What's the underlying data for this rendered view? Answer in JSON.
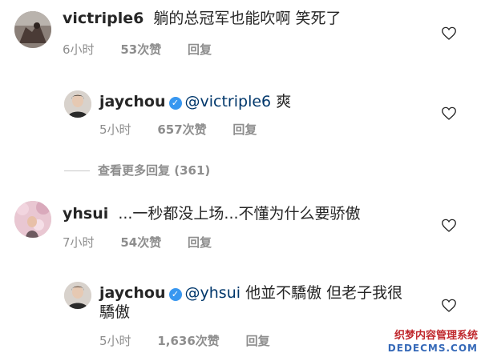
{
  "comments": [
    {
      "username": "victriple6",
      "text": "躺的总冠军也能吹啊  笑死了",
      "time": "6小时",
      "likes": "53次赞",
      "reply": "回复"
    },
    {
      "username": "jaychou",
      "mention": "@victriple6",
      "text": " 爽",
      "time": "5小时",
      "likes": "657次赞",
      "reply": "回复"
    },
    {
      "username": "yhsui",
      "text": "...一秒都没上场...不懂为什么要骄傲",
      "time": "7小时",
      "likes": "54次赞",
      "reply": "回复"
    },
    {
      "username": "jaychou",
      "mention": "@yhsui",
      "text_line1": " 他並不驕傲 但老子我很",
      "text_line2": "驕傲",
      "time": "5小时",
      "likes": "1,636次赞",
      "reply": "回复"
    }
  ],
  "view_more": "查看更多回复 (361)",
  "watermark": {
    "line1": "织梦内容管理系统",
    "line2": "DEDECMS.COM"
  },
  "colors": {
    "verified": "#3897f0",
    "mention": "#00376b",
    "meta": "#8e8e8e"
  }
}
